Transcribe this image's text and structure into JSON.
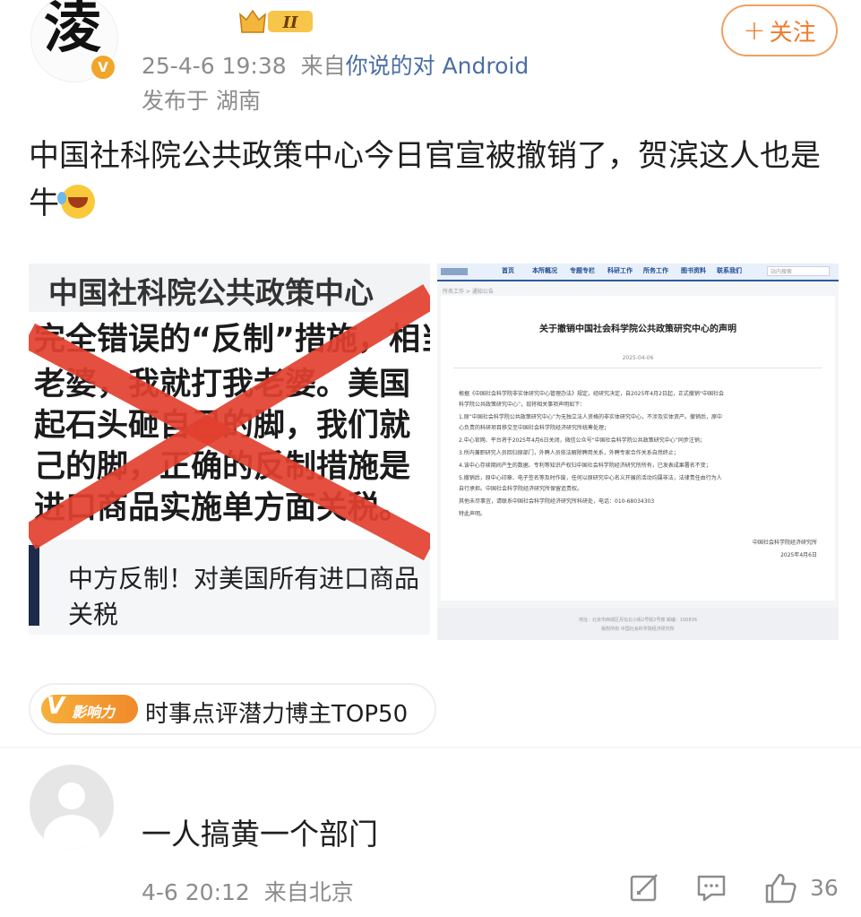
{
  "header": {
    "avatar_glyph": "淩",
    "level_badge": "II",
    "follow_label": "关注",
    "follow_plus": "+",
    "time": "25-4-6 19:38",
    "source_prefix": "来自",
    "source": "你说的对 Android",
    "location": "发布于 湖南"
  },
  "post": {
    "text": "中国社科院公共政策中心今日官宣被撤销了，贺滨这人也是牛"
  },
  "image1": {
    "header": "中国社科院公共政策中心",
    "lines": [
      "完全错误的“反制”措施，相当",
      "老婆，我就打我老婆。美国",
      "起石头砸自己的脚，我们就",
      "己的脚，正确的反制措施是",
      "进口商品实施单方面关税。"
    ],
    "caption_line1": "中方反制！对美国所有进口商品",
    "caption_line2": "关税"
  },
  "image2": {
    "nav": [
      "首页",
      "本所概况",
      "专题专栏",
      "科研工作",
      "所务工作",
      "图书资料",
      "联系我们"
    ],
    "search_placeholder": "站内搜索",
    "breadcrumb": "所务工作 > 通知公告",
    "title": "关于撤销中国社会科学院公共政策研究中心的声明",
    "date": "2025-04-06",
    "body": [
      "根据《中国社会科学院非实体研究中心管理办法》规定，经研究决定，自2025年4月2日起，正式撤销“中国社会",
      "科学院公共政策研究中心”，现将相关事项声明如下：",
      "1.原“中国社会科学院公共政策研究中心”为无独立法人资格的非实体研究中心，不涉及实体资产。撤销后，原中",
      "心负责的科研项目移交至中国社会科学院经济研究所统筹处理；",
      "2.中心官网、平台将于2025年4月6日关闭，微信公众号“中国社会科学院公共政策研究中心”同步注销；",
      "3.所内兼职研究人员回归原部门，外聘人员依法解除聘用关系，外聘专家合作关系自然终止；",
      "4.该中心存续期间产生的数据、专利等知识产权归中国社会科学院经济研究所所有，已发表成果署名不变；",
      "5.撤销后，原中心印章、电子签名等及时作废，任何以原研究中心名义开展的活动均属非法，法律责任由行为人",
      "自行承担。中国社会科学院经济研究所保留追责权。",
      "其他未尽事宜，请联系中国社会科学院经济研究所科研处，电话：010-68034303",
      "特此声明。"
    ],
    "signature": "中国社会科学院经济研究所",
    "sign_date": "2025年4月6日",
    "footer1": "地址：北京市西城区月坛北小街2号院2号楼   邮编：100836",
    "footer2": "版权所有  中国社会科学院经济研究所"
  },
  "influence": {
    "v": "V",
    "tag": "影响力",
    "label": "时事点评潜力博主TOP50"
  },
  "comment": {
    "text": "一人搞黄一个部门",
    "time": "4-6 20:12",
    "from": "来自北京",
    "likes": "36"
  },
  "icons": {
    "repost": "repost-icon",
    "reply": "reply-icon",
    "like": "like-icon"
  },
  "colors": {
    "accent_orange": "#ee7c2c",
    "link_blue": "#4b6ea3",
    "meta_gray": "#8c8c8c",
    "cross_red": "#e2402f"
  }
}
